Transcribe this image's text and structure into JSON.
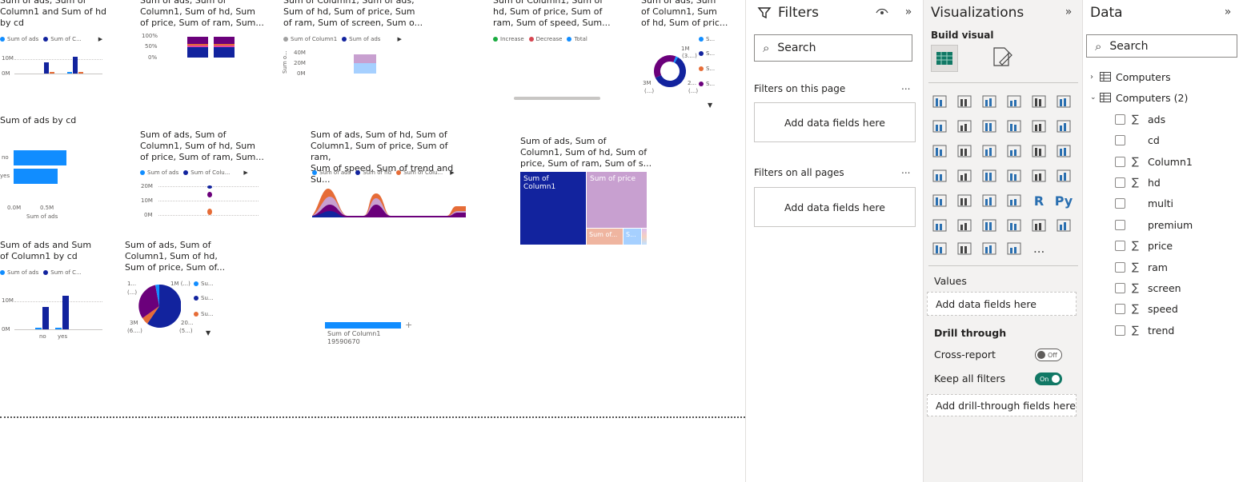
{
  "canvas": {
    "visual1": {
      "title": "Sum of ads, Sum of\nColumn1 and Sum of hd\nby cd",
      "legend": [
        "Sum of ads",
        "Sum of C..."
      ],
      "yticks": [
        "10M",
        "0M"
      ]
    },
    "visual2": {
      "title": "Sum of ads, Sum of\nColumn1, Sum of hd, Sum\nof price, Sum of ram, Sum...",
      "yticks": [
        "100%",
        "50%",
        "0%"
      ]
    },
    "visual3": {
      "title": "Sum of Column1, Sum of ads,\nSum of hd, Sum of price, Sum\nof ram, Sum of screen, Sum o...",
      "legend": [
        "Sum of Column1",
        "Sum of ads"
      ],
      "yticks": [
        "40M",
        "20M",
        "0M"
      ],
      "yaxis_label": "Sum o..."
    },
    "visual4": {
      "title": "Sum of Column1, Sum of\nhd, Sum of price, Sum of\nram, Sum of speed, Sum...",
      "legend": [
        "Increase",
        "Decrease",
        "Total"
      ]
    },
    "visual5": {
      "title": "Sum of ads, Sum\nof Column1, Sum\nof hd, Sum of pric...",
      "labels": [
        "1M",
        "(3....)",
        "3M",
        "(...)",
        "2...",
        "(...)"
      ],
      "legend": [
        "S...",
        "S...",
        "S...",
        "S..."
      ]
    },
    "visual6": {
      "title": "Sum of ads by cd",
      "categories": [
        "no",
        "yes"
      ],
      "xticks": [
        "0.0M",
        "0.5M"
      ],
      "xlabel": "Sum of ads"
    },
    "visual7": {
      "title": "Sum of ads, Sum of\nColumn1, Sum of hd, Sum\nof price, Sum of ram, Sum...",
      "legend": [
        "Sum of ads",
        "Sum of Colu..."
      ],
      "yticks": [
        "20M",
        "10M",
        "0M"
      ]
    },
    "visual8": {
      "title": "Sum of ads, Sum of hd, Sum of\nColumn1, Sum of price, Sum of ram,\nSum of speed, Sum of trend and Su...",
      "legend": [
        "Sum of ads",
        "Sum of hd",
        "Sum of Colu..."
      ]
    },
    "visual9": {
      "title": "Sum of ads, Sum of\nColumn1, Sum of hd, Sum of\nprice, Sum of ram, Sum of s...",
      "tiles": [
        "Sum of Column1",
        "Sum of price",
        "Sum of...",
        "S..."
      ]
    },
    "visual10": {
      "title": "Sum of ads and Sum\nof Column1 by cd",
      "legend": [
        "Sum of ads",
        "Sum of C..."
      ],
      "yticks": [
        "10M",
        "0M"
      ],
      "categories": [
        "no",
        "yes"
      ]
    },
    "visual11": {
      "title": "Sum of ads, Sum of\nColumn1, Sum of hd,\nSum of price, Sum of...",
      "labels": [
        "1...",
        "(...)",
        "1M (...)",
        "3M",
        "(6....)",
        "20...",
        "(5...)"
      ],
      "legend": [
        "Su...",
        "Su...",
        "Su..."
      ]
    },
    "visual12": {
      "label": "Sum of Column1",
      "value": "19590670"
    }
  },
  "filters": {
    "title": "Filters",
    "search_placeholder": "Search",
    "on_this_page": "Filters on this page",
    "on_all_pages": "Filters on all pages",
    "add_fields": "Add data fields here",
    "more": "..."
  },
  "visualizations": {
    "title": "Visualizations",
    "build_visual": "Build visual",
    "values_label": "Values",
    "values_placeholder": "Add data fields here",
    "drill_through": "Drill through",
    "cross_report": "Cross-report",
    "cross_report_state": "Off",
    "keep_all_filters": "Keep all filters",
    "keep_all_filters_state": "On",
    "drill_placeholder": "Add drill-through fields here",
    "more": "..."
  },
  "data": {
    "title": "Data",
    "search_placeholder": "Search",
    "tables": [
      "Computers",
      "Computers (2)"
    ],
    "fields": [
      {
        "name": "ads",
        "sigma": true
      },
      {
        "name": "cd",
        "sigma": false
      },
      {
        "name": "Column1",
        "sigma": true
      },
      {
        "name": "hd",
        "sigma": true
      },
      {
        "name": "multi",
        "sigma": false
      },
      {
        "name": "premium",
        "sigma": false
      },
      {
        "name": "price",
        "sigma": true
      },
      {
        "name": "ram",
        "sigma": true
      },
      {
        "name": "screen",
        "sigma": true
      },
      {
        "name": "speed",
        "sigma": true
      },
      {
        "name": "trend",
        "sigma": true
      }
    ]
  },
  "colors": {
    "blue": "#118dff",
    "navy": "#12239e",
    "orange": "#e66c37",
    "purple": "#6b007b",
    "pink": "#e044a7",
    "lavender": "#c8a0d0",
    "teal": "#1a7a5a"
  }
}
